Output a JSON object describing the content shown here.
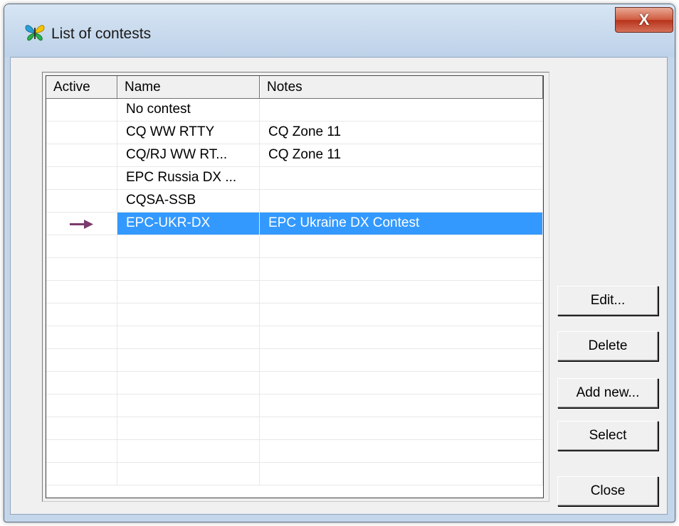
{
  "window": {
    "title": "List of contests",
    "close_label": "X"
  },
  "table": {
    "columns": [
      "Active",
      "Name",
      "Notes"
    ],
    "rows": [
      {
        "active": "",
        "name": "No contest",
        "notes": ""
      },
      {
        "active": "",
        "name": "CQ WW RTTY",
        "notes": "CQ Zone 11"
      },
      {
        "active": "",
        "name": "CQ/RJ WW RT...",
        "notes": "CQ Zone 11"
      },
      {
        "active": "",
        "name": "EPC Russia DX ...",
        "notes": ""
      },
      {
        "active": "",
        "name": "CQSA-SSB",
        "notes": ""
      },
      {
        "active": "arrow",
        "name": "EPC-UKR-DX",
        "notes": "EPC Ukraine DX Contest"
      }
    ],
    "selected_row": 5
  },
  "buttons": {
    "edit": "Edit...",
    "delete": "Delete",
    "add_new": "Add new...",
    "select": "Select",
    "close": "Close"
  },
  "icons": {
    "app": "butterfly-icon",
    "active_marker": "right-arrow-icon"
  },
  "colors": {
    "selection": "#3399ff",
    "active_arrow": "#7a3b6e",
    "close_button": "#c9482b"
  }
}
